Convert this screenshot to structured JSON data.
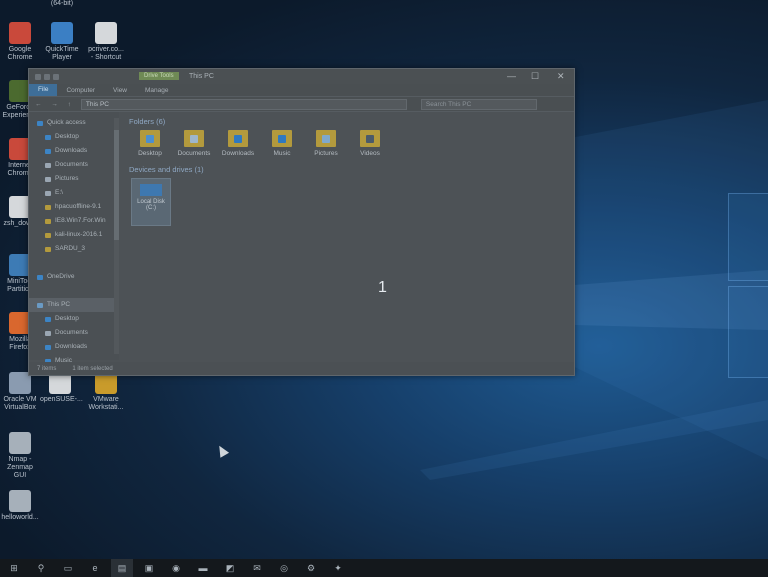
{
  "desktop": {
    "top_label": "(64-bit)",
    "icons": [
      {
        "name": "google-chrome-icon",
        "label": "Google Chrome",
        "color": "#c9493b"
      },
      {
        "name": "quicktime-icon",
        "label": "QuickTime Player",
        "color": "#3b7fc4"
      },
      {
        "name": "shortcut-file-icon",
        "label": "pcriver.co... - Shortcut",
        "color": "#d5d8db"
      },
      {
        "name": "geforce-icon",
        "label": "GeForce Experience",
        "color": "#4b6a2f"
      },
      {
        "name": "internet-chrome-icon",
        "label": "Internet Chrome",
        "color": "#c9493b"
      },
      {
        "name": "file-icon",
        "label": "zsh_dow...",
        "color": "#d5d8db"
      },
      {
        "name": "minitool-icon",
        "label": "MiniTool Partition",
        "color": "#3d7bb5"
      },
      {
        "name": "firefox-icon",
        "label": "Mozilla Firefox",
        "color": "#d9672e"
      },
      {
        "name": "virtualbox-icon",
        "label": "Oracle VM VirtualBox",
        "color": "#8a9bb0"
      },
      {
        "name": "opensuse-icon",
        "label": "openSUSE-...",
        "color": "#d5d8db"
      },
      {
        "name": "vmware-icon",
        "label": "VMware Workstati...",
        "color": "#c99b2b"
      },
      {
        "name": "zenmap-icon",
        "label": "Nmap - Zenmap GUI",
        "color": "#a6b0ba"
      },
      {
        "name": "helloworld-icon",
        "label": "helloworld...",
        "color": "#a6b0ba"
      }
    ]
  },
  "explorer": {
    "title": "This PC",
    "context_tab": "Drive Tools",
    "ribbon_tabs": [
      "File",
      "Computer",
      "View",
      "Manage"
    ],
    "nav_arrows": "← → ↑",
    "address_path": "This PC",
    "search_placeholder": "Search This PC",
    "nav_pane": [
      {
        "label": "Quick access",
        "color": "#3c84c5",
        "indent": 8
      },
      {
        "label": "Desktop",
        "color": "#3c84c5",
        "indent": 16
      },
      {
        "label": "Downloads",
        "color": "#3c84c5",
        "indent": 16
      },
      {
        "label": "Documents",
        "color": "#9aa6b2",
        "indent": 16
      },
      {
        "label": "Pictures",
        "color": "#9aa6b2",
        "indent": 16
      },
      {
        "label": "E:\\",
        "color": "#9aa6b2",
        "indent": 16
      },
      {
        "label": "hpacuoffline-9.1",
        "color": "#b39a3d",
        "indent": 16
      },
      {
        "label": "IE8.Win7.For.Win",
        "color": "#b39a3d",
        "indent": 16
      },
      {
        "label": "kali-linux-2016.1",
        "color": "#b39a3d",
        "indent": 16
      },
      {
        "label": "SARDU_3",
        "color": "#b39a3d",
        "indent": 16
      },
      {
        "label": "",
        "color": "transparent",
        "indent": 16
      },
      {
        "label": "OneDrive",
        "color": "#3c84c5",
        "indent": 8
      },
      {
        "label": "",
        "color": "transparent",
        "indent": 16
      },
      {
        "label": "This PC",
        "color": "#6a9ac4",
        "indent": 8
      },
      {
        "label": "Desktop",
        "color": "#3c84c5",
        "indent": 16
      },
      {
        "label": "Documents",
        "color": "#9aa6b2",
        "indent": 16
      },
      {
        "label": "Downloads",
        "color": "#3c84c5",
        "indent": 16
      },
      {
        "label": "Music",
        "color": "#3c84c5",
        "indent": 16
      }
    ],
    "folders_header": "Folders (6)",
    "folders": [
      {
        "label": "Desktop",
        "badge": "#4c8fd0"
      },
      {
        "label": "Documents",
        "badge": "#9eb6cc"
      },
      {
        "label": "Downloads",
        "badge": "#2f79c0"
      },
      {
        "label": "Music",
        "badge": "#2f79c0"
      },
      {
        "label": "Pictures",
        "badge": "#7fa8cc"
      },
      {
        "label": "Videos",
        "badge": "#4a5a6a"
      }
    ],
    "drives_header": "Devices and drives (1)",
    "drive": {
      "label": "Local Disk (C:)"
    },
    "status_items": "7 items",
    "status_selected": "1 item selected"
  },
  "overlay_number": "1",
  "taskbar": {
    "items": [
      {
        "name": "start-icon",
        "glyph": "⊞"
      },
      {
        "name": "search-icon",
        "glyph": "⚲"
      },
      {
        "name": "task-view-icon",
        "glyph": "▭"
      },
      {
        "name": "edge-icon",
        "glyph": "e"
      },
      {
        "name": "file-explorer-icon",
        "glyph": "▤"
      },
      {
        "name": "store-icon",
        "glyph": "▣"
      },
      {
        "name": "firefox-icon",
        "glyph": "◉"
      },
      {
        "name": "remote-desktop-icon",
        "glyph": "▬"
      },
      {
        "name": "tool-icon",
        "glyph": "◩"
      },
      {
        "name": "mail-icon",
        "glyph": "✉"
      },
      {
        "name": "chrome-icon",
        "glyph": "◎"
      },
      {
        "name": "settings-icon",
        "glyph": "⚙"
      },
      {
        "name": "app-icon",
        "glyph": "✦"
      }
    ]
  }
}
